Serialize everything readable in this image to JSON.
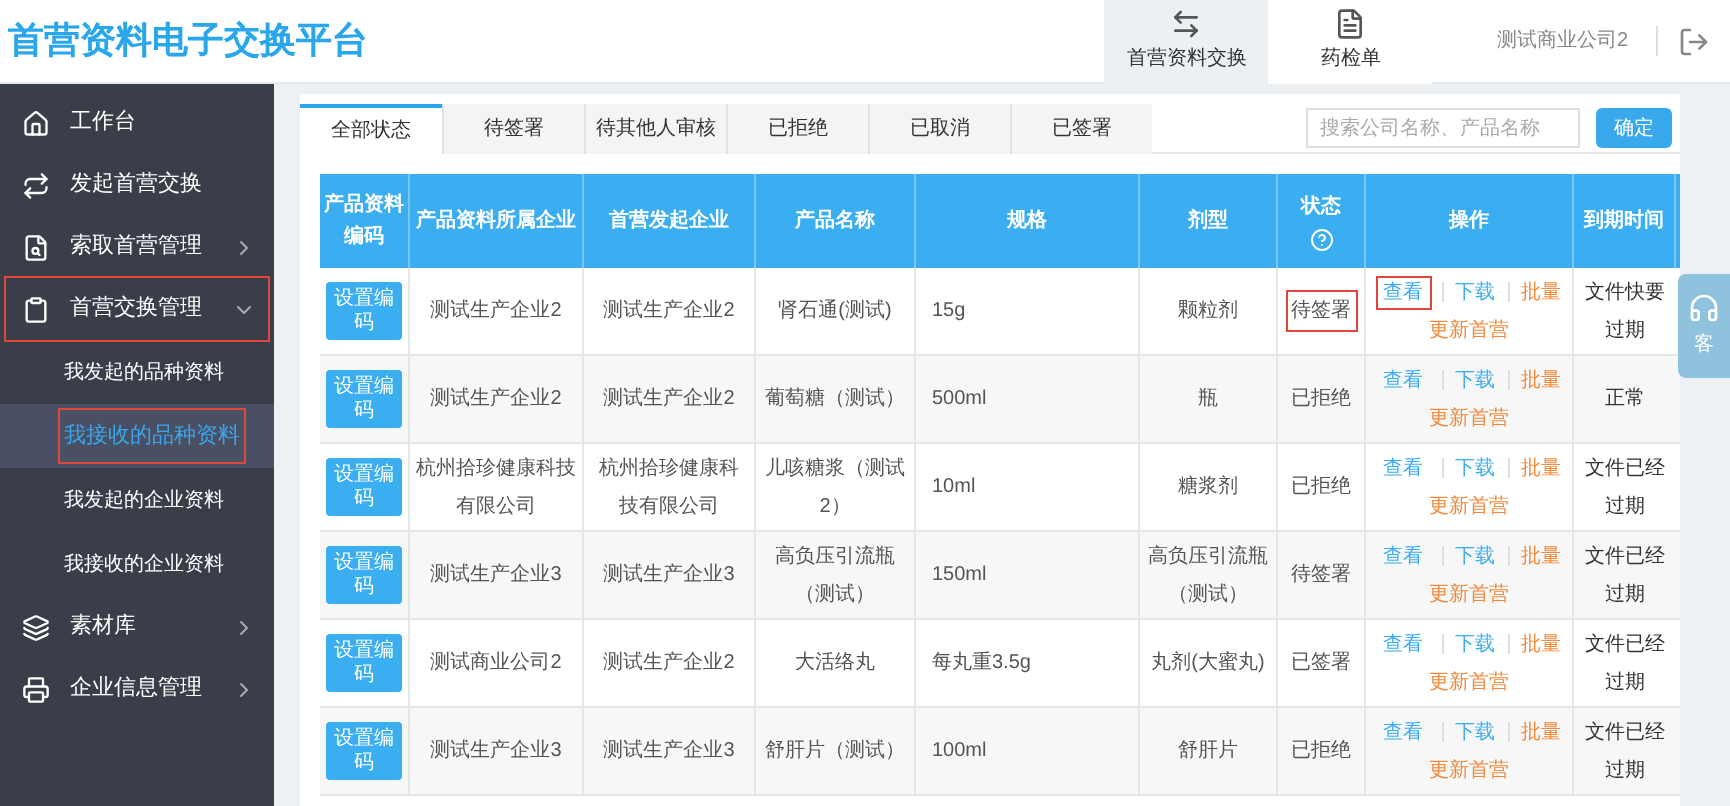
{
  "header": {
    "title": "首营资料电子交换平台",
    "nav": [
      {
        "label": "首营资料交换",
        "selected": true
      },
      {
        "label": "药检单",
        "selected": false
      }
    ],
    "user": "测试商业公司2"
  },
  "sidebar": {
    "items": [
      {
        "label": "工作台",
        "kind": "link",
        "annotated": false
      },
      {
        "label": "发起首营交换",
        "kind": "link",
        "annotated": false
      },
      {
        "label": "索取首营管理",
        "kind": "group",
        "expanded": false,
        "annotated": false
      },
      {
        "label": "首营交换管理",
        "kind": "group",
        "expanded": true,
        "annotated": true,
        "children": [
          {
            "label": "我发起的品种资料",
            "selected": false,
            "annotated": false
          },
          {
            "label": "我接收的品种资料",
            "selected": true,
            "annotated": true
          },
          {
            "label": "我发起的企业资料",
            "selected": false,
            "annotated": false
          },
          {
            "label": "我接收的企业资料",
            "selected": false,
            "annotated": false
          }
        ]
      },
      {
        "label": "素材库",
        "kind": "group",
        "expanded": false,
        "annotated": false
      },
      {
        "label": "企业信息管理",
        "kind": "group",
        "expanded": false,
        "annotated": false
      }
    ]
  },
  "tabs": [
    {
      "label": "全部状态",
      "selected": true
    },
    {
      "label": "待签署",
      "selected": false
    },
    {
      "label": "待其他人审核",
      "selected": false
    },
    {
      "label": "已拒绝",
      "selected": false
    },
    {
      "label": "已取消",
      "selected": false
    },
    {
      "label": "已签署",
      "selected": false
    }
  ],
  "search": {
    "placeholder": "搜索公司名称、产品名称",
    "button": "确定"
  },
  "table": {
    "columns": [
      "产品资料编码",
      "产品资料所属企业",
      "首营发起企业",
      "产品名称",
      "规格",
      "剂型",
      "状态",
      "操作",
      "到期时间"
    ],
    "rows": [
      {
        "code_button": "设置编码",
        "owner": "测试生产企业2",
        "initiator": "测试生产企业2",
        "product": "肾石通(测试)",
        "spec": "15g",
        "form": "颗粒剂",
        "status": "待签署",
        "status_annotated": true,
        "actions": [
          "查看",
          "下载",
          "批量",
          "更新首营"
        ],
        "view_annotated": true,
        "expiry": "文件快要过期"
      },
      {
        "code_button": "设置编码",
        "owner": "测试生产企业2",
        "initiator": "测试生产企业2",
        "product": "葡萄糖（测试）",
        "spec": "500ml",
        "form": "瓶",
        "status": "已拒绝",
        "status_annotated": false,
        "actions": [
          "查看",
          "下载",
          "批量",
          "更新首营"
        ],
        "view_annotated": false,
        "expiry": "正常"
      },
      {
        "code_button": "设置编码",
        "owner": "杭州拾珍健康科技有限公司",
        "initiator": "杭州拾珍健康科技有限公司",
        "product": "儿咳糖浆（测试2）",
        "spec": "10ml",
        "form": "糖浆剂",
        "status": "已拒绝",
        "status_annotated": false,
        "actions": [
          "查看",
          "下载",
          "批量",
          "更新首营"
        ],
        "view_annotated": false,
        "expiry": "文件已经过期"
      },
      {
        "code_button": "设置编码",
        "owner": "测试生产企业3",
        "initiator": "测试生产企业3",
        "product": "高负压引流瓶（测试）",
        "spec": "150ml",
        "form": "高负压引流瓶（测试）",
        "status": "待签署",
        "status_annotated": false,
        "actions": [
          "查看",
          "下载",
          "批量",
          "更新首营"
        ],
        "view_annotated": false,
        "expiry": "文件已经过期"
      },
      {
        "code_button": "设置编码",
        "owner": "测试商业公司2",
        "initiator": "测试生产企业2",
        "product": "大活络丸",
        "spec": "每丸重3.5g",
        "form": "丸剂(大蜜丸)",
        "status": "已签署",
        "status_annotated": false,
        "actions": [
          "查看",
          "下载",
          "批量",
          "更新首营"
        ],
        "view_annotated": false,
        "expiry": "文件已经过期"
      },
      {
        "code_button": "设置编码",
        "owner": "测试生产企业3",
        "initiator": "测试生产企业3",
        "product": "舒肝片（测试）",
        "spec": "100ml",
        "form": "舒肝片",
        "status": "已拒绝",
        "status_annotated": false,
        "actions": [
          "查看",
          "下载",
          "批量",
          "更新首营"
        ],
        "view_annotated": false,
        "expiry": "文件已经过期"
      }
    ]
  },
  "support": {
    "label": "客"
  }
}
